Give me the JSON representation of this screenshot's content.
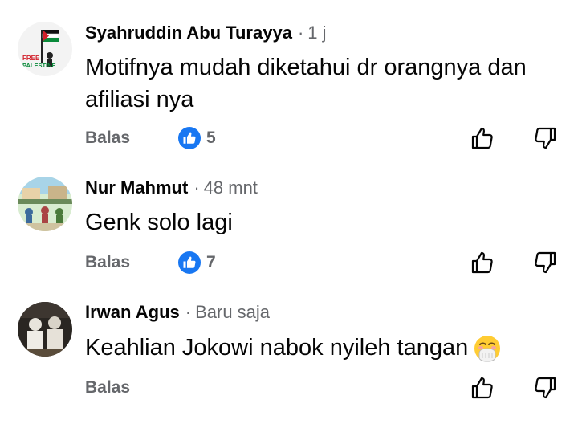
{
  "comments": [
    {
      "author": "Syahruddin Abu Turayya",
      "time": "1 j",
      "text_line1": "Motifnya mudah diketahui dr orangnya dan",
      "text_line2": "afiliasi nya",
      "reply_label": "Balas",
      "like_count": "5",
      "avatar_text_top": "FREE",
      "avatar_text_bottom": "PALESTINE"
    },
    {
      "author": "Nur Mahmut",
      "time": "48 mnt",
      "text": "Genk solo lagi",
      "reply_label": "Balas",
      "like_count": "7"
    },
    {
      "author": "Irwan Agus",
      "time": "Baru saja",
      "text": "Keahlian Jokowi nabok nyileh tangan",
      "emoji": "face-with-hand-over-mouth-emoji",
      "reply_label": "Balas"
    }
  ],
  "colors": {
    "like_blue": "#1877f2",
    "secondary_text": "#65676b",
    "primary_text": "#050505"
  },
  "icons": {
    "like_badge": "thumbs-up-icon",
    "like_action": "thumbs-up-outline-icon",
    "dislike_action": "thumbs-down-outline-icon"
  }
}
